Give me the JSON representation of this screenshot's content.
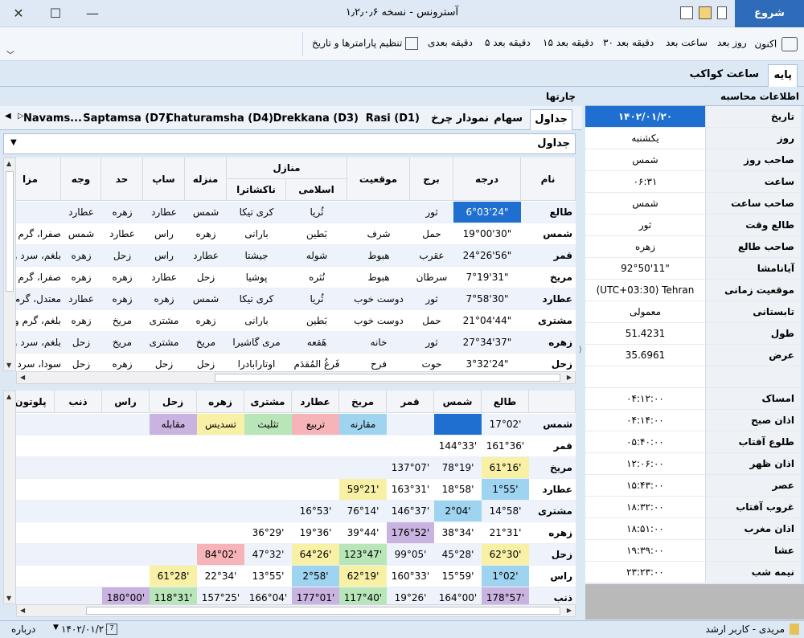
{
  "window": {
    "title": "آسترونس - نسخه ۱٫۲٫۰٫۶",
    "tab_start": "شروع"
  },
  "ribbon": {
    "now": "اکنون",
    "next_day": "روز بعد",
    "next_hour": "ساعت بعد",
    "min30": "۳۰ دقیقه بعد",
    "min15": "۱۵ دقیقه بعد",
    "min5": "۵ دقیقه بعد",
    "next_min": "دقیقه بعدی",
    "set_params": "تنظیم پارامترها و تاریخ"
  },
  "pagetabs": {
    "base": "پایه",
    "planet_hours": "ساعت کواکب"
  },
  "calc": {
    "header": "اطلاعات محاسبه",
    "rows": [
      {
        "label": "تاریخ",
        "value": "۱۴۰۲/۰۱/۲۰"
      },
      {
        "label": "روز",
        "value": "یکشنبه"
      },
      {
        "label": "صاحب روز",
        "value": "شمس"
      },
      {
        "label": "ساعت",
        "value": "۰۶:۳۱"
      },
      {
        "label": "صاحب ساعت",
        "value": "شمس"
      },
      {
        "label": "طالع وقت",
        "value": "ثور"
      },
      {
        "label": "صاحب طالع",
        "value": "زهره"
      },
      {
        "label": "آیانامشا",
        "value": "92°50'11\""
      },
      {
        "label": "موقعیت زمانی",
        "value": "(UTC+03:30) Tehran"
      },
      {
        "label": "تابستانی",
        "value": "معمولی"
      },
      {
        "label": "طول",
        "value": "51.4231"
      },
      {
        "label": "عرض",
        "value": "35.6961"
      },
      {
        "label": "",
        "value": ""
      },
      {
        "label": "امساک",
        "value": "۰۴:۱۲:۰۰"
      },
      {
        "label": "اذان صبح",
        "value": "۰۴:۱۴:۰۰"
      },
      {
        "label": "طلوع آفتاب",
        "value": "۰۵:۴۰:۰۰"
      },
      {
        "label": "اذان ظهر",
        "value": "۱۲:۰۶:۰۰"
      },
      {
        "label": "عصر",
        "value": "۱۵:۴۳:۰۰"
      },
      {
        "label": "غروب آفتاب",
        "value": "۱۸:۳۲:۰۰"
      },
      {
        "label": "اذان مغرب",
        "value": "۱۸:۵۱:۰۰"
      },
      {
        "label": "عشا",
        "value": "۱۹:۳۹:۰۰"
      },
      {
        "label": "نیمه شب",
        "value": "۲۳:۲۳:۰۰"
      }
    ]
  },
  "charts": {
    "header": "چارتها",
    "tabs": [
      "جداول",
      "سهام",
      "نمودار چرخ",
      "Rasi (D1)",
      "Drekkana (D3)",
      "Chaturamsha (D4)",
      "Saptamsa (D7)",
      "Navams..."
    ],
    "combo": "جداول"
  },
  "table1": {
    "headers": {
      "name": "نام",
      "degree": "درجه",
      "sign": "برج",
      "position": "موقعیت",
      "manazil": "منازل",
      "islamic": "اسلامی",
      "nakshatra": "ناکشاترا",
      "manzele": "منزله",
      "sap": "ساپ",
      "had": "حد",
      "vajh": "وجه",
      "mezaj": "مزا"
    },
    "rows": [
      [
        "طالع",
        "6°03'24\"",
        "ثور",
        "",
        "ثُریا",
        "کری تیکا",
        "شمس",
        "عطارد",
        "زهره",
        "عطارد",
        ""
      ],
      [
        "شمس",
        "19°00'30\"",
        "حمل",
        "شرف",
        "بَطین",
        "بارانی",
        "زهره",
        "راس",
        "عطارد",
        "شمس",
        "صفرا، گرم و"
      ],
      [
        "قمر",
        "24°26'56\"",
        "عقرب",
        "هبوط",
        "شوله",
        "جیشتا",
        "عطارد",
        "راس",
        "زحل",
        "زهره",
        "بلغم، سرد و"
      ],
      [
        "مریخ",
        "7°19'31\"",
        "سرطان",
        "هبوط",
        "نُثره",
        "پوشیا",
        "زحل",
        "عطارد",
        "زهره",
        "زهره",
        "صفرا، گرم و"
      ],
      [
        "عطارد",
        "7°58'30\"",
        "ثور",
        "دوست خوب",
        "ثُریا",
        "کری تیکا",
        "شمس",
        "زهره",
        "زهره",
        "عطارد",
        "معتدل، گرم"
      ],
      [
        "مشتری",
        "21°04'44\"",
        "حمل",
        "دوست خوب",
        "بَطین",
        "بارانی",
        "زهره",
        "مشتری",
        "مریخ",
        "زهره",
        "بلغم، گرم و"
      ],
      [
        "زهره",
        "27°34'37\"",
        "ثور",
        "خانه",
        "هَقعه",
        "مری گاشیرا",
        "مریخ",
        "مشتری",
        "مریخ",
        "زحل",
        "بلغم، سرد و"
      ],
      [
        "زحل",
        "3°32'24\"",
        "حوت",
        "فرح",
        "فَرغُ المُقدَم",
        "اوتارابادرا",
        "زحل",
        "زحل",
        "زهره",
        "زحل",
        "سودا، سرد و"
      ]
    ]
  },
  "table2": {
    "headers": [
      "طالع",
      "شمس",
      "قمر",
      "مریخ",
      "عطارد",
      "مشتری",
      "زهره",
      "زحل",
      "راس",
      "ذنب",
      "پلوتون"
    ],
    "rows": [
      {
        "name": "شمس",
        "cells": [
          "17°02'",
          "",
          "",
          "مقارنه",
          "تربیع",
          "تثلیث",
          "تسدیس",
          "مقابله",
          "",
          "",
          ""
        ]
      },
      {
        "name": "قمر",
        "cells": [
          "161°36'",
          "144°33'",
          "",
          "",
          "",
          "",
          "",
          "",
          "",
          "",
          ""
        ]
      },
      {
        "name": "مریخ",
        "cells": [
          "61°16'",
          "78°19'",
          "137°07'",
          "",
          "",
          "",
          "",
          "",
          "",
          "",
          ""
        ]
      },
      {
        "name": "عطارد",
        "cells": [
          "1°55'",
          "18°58'",
          "163°31'",
          "59°21'",
          "",
          "",
          "",
          "",
          "",
          "",
          ""
        ]
      },
      {
        "name": "مشتری",
        "cells": [
          "14°58'",
          "2°04'",
          "146°37'",
          "76°14'",
          "16°53'",
          "",
          "",
          "",
          "",
          "",
          ""
        ]
      },
      {
        "name": "زهره",
        "cells": [
          "21°31'",
          "38°34'",
          "176°52'",
          "39°44'",
          "19°36'",
          "36°29'",
          "",
          "",
          "",
          "",
          ""
        ]
      },
      {
        "name": "زحل",
        "cells": [
          "62°30'",
          "45°28'",
          "99°05'",
          "123°47'",
          "64°26'",
          "47°32'",
          "84°02'",
          "",
          "",
          "",
          ""
        ]
      },
      {
        "name": "راس",
        "cells": [
          "1°02'",
          "15°59'",
          "160°33'",
          "62°19'",
          "2°58'",
          "13°55'",
          "22°34'",
          "61°28'",
          "",
          "",
          ""
        ]
      },
      {
        "name": "ذنب",
        "cells": [
          "178°57'",
          "164°00'",
          "19°26'",
          "117°40'",
          "177°01'",
          "166°04'",
          "157°25'",
          "118°31'",
          "180°00'",
          "",
          ""
        ]
      }
    ],
    "colors": {
      "conj": "#9fd4f0",
      "square": "#f6b3b8",
      "trine": "#b8e6b8",
      "sextile": "#f7f0a5",
      "opp": "#c9b3e0",
      "sel": "#1e6fd0"
    }
  },
  "status": {
    "user": "مریدی - کاربر ارشد",
    "date": "۱۴۰۲/۰۱/۲۰",
    "about": "درباره"
  }
}
